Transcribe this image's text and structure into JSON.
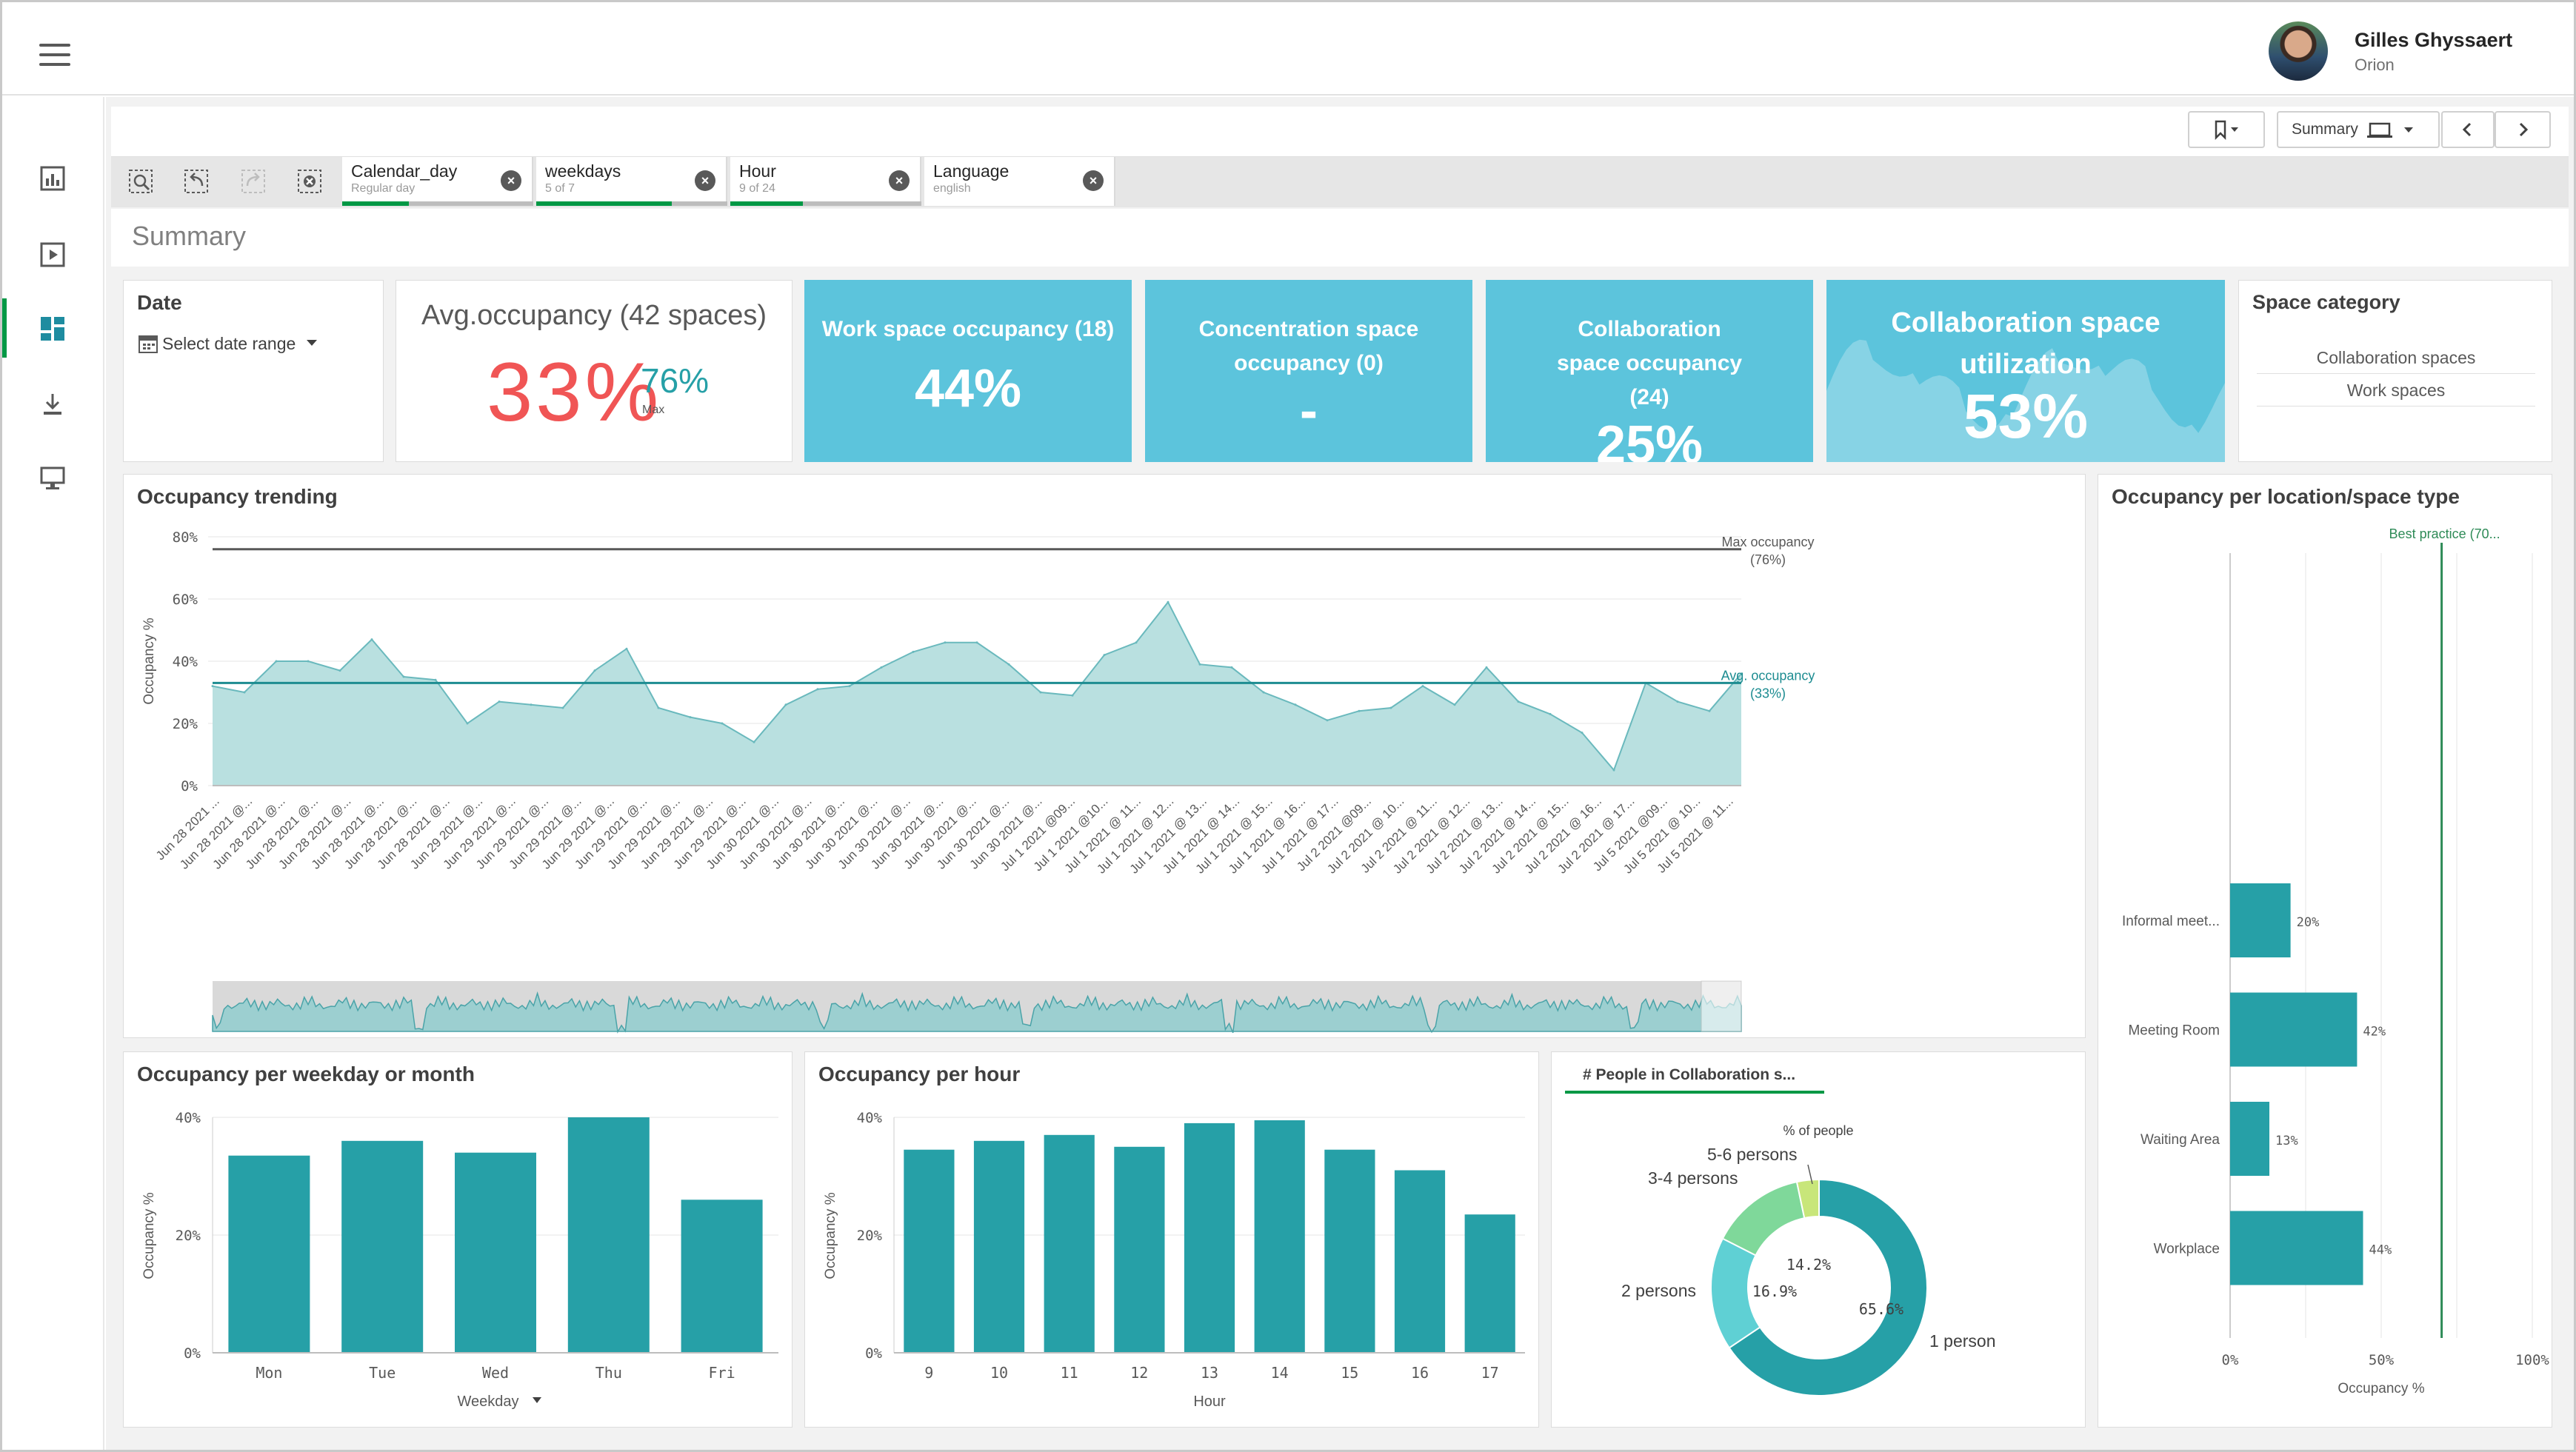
{
  "user": {
    "name": "Gilles Ghyssaert",
    "org": "Orion"
  },
  "toolbar": {
    "sheet_selector": "Summary"
  },
  "selections": [
    {
      "field": "Calendar_day",
      "state": "Regular day",
      "ratio": 0.35
    },
    {
      "field": "weekdays",
      "state": "5 of 7",
      "ratio": 0.71
    },
    {
      "field": "Hour",
      "state": "9 of 24",
      "ratio": 0.38
    },
    {
      "field": "Language",
      "state": "english",
      "ratio": 1.0
    }
  ],
  "sheet": {
    "title": "Summary"
  },
  "date_filter": {
    "title": "Date",
    "select_label": "Select date range"
  },
  "avg_kpi": {
    "title": "Avg.occupancy (42 spaces)",
    "value": "33%",
    "max_value": "76%",
    "max_label": "Max"
  },
  "kpis": [
    {
      "title": "Work space occupancy (18)",
      "value": "44%"
    },
    {
      "title": "Concentration space occupancy (0)",
      "value": "-"
    },
    {
      "title": "Collaboration space occupancy (24)",
      "value": "25%"
    },
    {
      "title": "Collaboration space utilization",
      "value": "53%"
    }
  ],
  "space_category": {
    "title": "Space category",
    "items": [
      "Collaboration spaces",
      "Work spaces"
    ]
  },
  "colors": {
    "teal": "#26a0a7",
    "teal_light": "#b9e0e0",
    "kpi_bg": "#5cc4dc",
    "red": "#f05555",
    "green": "#009845"
  },
  "chart_data": [
    {
      "type": "area",
      "title": "Occupancy trending",
      "ylabel": "Occupancy %",
      "ylim": [
        0,
        80
      ],
      "yticks": [
        "0%",
        "20%",
        "40%",
        "60%",
        "80%"
      ],
      "categories": [
        "Jun 28 2021 ...",
        "Jun 28 2021 @...",
        "Jun 28 2021 @...",
        "Jun 28 2021 @...",
        "Jun 28 2021 @...",
        "Jun 28 2021 @...",
        "Jun 28 2021 @...",
        "Jun 28 2021 @...",
        "Jun 29 2021 @...",
        "Jun 29 2021 @...",
        "Jun 29 2021 @...",
        "Jun 29 2021 @...",
        "Jun 29 2021 @...",
        "Jun 29 2021 @...",
        "Jun 29 2021 @...",
        "Jun 29 2021 @...",
        "Jun 29 2021 @...",
        "Jun 30 2021 @...",
        "Jun 30 2021 @...",
        "Jun 30 2021 @...",
        "Jun 30 2021 @...",
        "Jun 30 2021 @...",
        "Jun 30 2021 @...",
        "Jun 30 2021 @...",
        "Jun 30 2021 @...",
        "Jun 30 2021 @...",
        "Jul 1 2021 @09...",
        "Jul 1 2021 @10...",
        "Jul 1 2021 @ 11...",
        "Jul 1 2021 @ 12...",
        "Jul 1 2021 @ 13...",
        "Jul 1 2021 @ 14...",
        "Jul 1 2021 @ 15...",
        "Jul 1 2021 @ 16...",
        "Jul 1 2021 @ 17...",
        "Jul 2 2021 @09...",
        "Jul 2 2021 @ 10...",
        "Jul 2 2021 @ 11...",
        "Jul 2 2021 @ 12...",
        "Jul 2 2021 @ 13...",
        "Jul 2 2021 @ 14...",
        "Jul 2 2021 @ 15...",
        "Jul 2 2021 @ 16...",
        "Jul 2 2021 @ 17...",
        "Jul 5 2021 @09...",
        "Jul 5 2021 @ 10...",
        "Jul 5 2021 @ 11..."
      ],
      "values": [
        32,
        30,
        40,
        40,
        37,
        47,
        35,
        34,
        20,
        27,
        26,
        25,
        37,
        44,
        25,
        22,
        20,
        14,
        26,
        31,
        32,
        38,
        43,
        46,
        46,
        39,
        30,
        29,
        42,
        46,
        59,
        39,
        38,
        30,
        26,
        21,
        24,
        25,
        32,
        26,
        38,
        27,
        23,
        17,
        5,
        33,
        27,
        24,
        36
      ],
      "reference_lines": [
        {
          "label": "Max occupancy",
          "sublabel": "(76%)",
          "value": 76
        },
        {
          "label": "Avg. occupancy",
          "sublabel": "(33%)",
          "value": 33
        }
      ]
    },
    {
      "type": "bar",
      "title": "Occupancy per weekday or month",
      "xlabel": "Weekday",
      "ylabel": "Occupancy %",
      "ylim": [
        0,
        40
      ],
      "yticks": [
        "0%",
        "20%",
        "40%"
      ],
      "categories": [
        "Mon",
        "Tue",
        "Wed",
        "Thu",
        "Fri"
      ],
      "values": [
        33.5,
        36,
        34,
        40,
        26
      ]
    },
    {
      "type": "bar",
      "title": "Occupancy per hour",
      "xlabel": "Hour",
      "ylabel": "Occupancy %",
      "ylim": [
        0,
        40
      ],
      "yticks": [
        "0%",
        "20%",
        "40%"
      ],
      "categories": [
        "9",
        "10",
        "11",
        "12",
        "13",
        "14",
        "15",
        "16",
        "17"
      ],
      "values": [
        34.5,
        36,
        37,
        35,
        39,
        39.5,
        34.5,
        31,
        23.5
      ]
    },
    {
      "type": "pie",
      "title": "# People in Collaboration s...",
      "subtitle": "% of people",
      "slices": [
        {
          "label": "1 person",
          "value": 65.6,
          "color": "#26a0a7"
        },
        {
          "label": "2 persons",
          "value": 16.9,
          "color": "#5fd0d4"
        },
        {
          "label": "3-4 persons",
          "value": 14.2,
          "color": "#7fd89a"
        },
        {
          "label": "5-6 persons",
          "value": 3.3,
          "color": "#c8e67a"
        }
      ],
      "value_labels": [
        "65.6%",
        "16.9%",
        "14.2%"
      ]
    },
    {
      "type": "bar",
      "orientation": "horizontal",
      "title": "Occupancy per location/space type",
      "xlabel": "Occupancy %",
      "xlim": [
        0,
        100
      ],
      "xticks": [
        "0%",
        "50%",
        "100%"
      ],
      "categories": [
        "Informal meet...",
        "Meeting Room",
        "Waiting Area",
        "Workplace"
      ],
      "values": [
        20,
        42,
        13,
        44
      ],
      "value_labels": [
        "20%",
        "42%",
        "13%",
        "44%"
      ],
      "reference_line": {
        "label": "Best practice (70...",
        "value": 70
      }
    }
  ]
}
